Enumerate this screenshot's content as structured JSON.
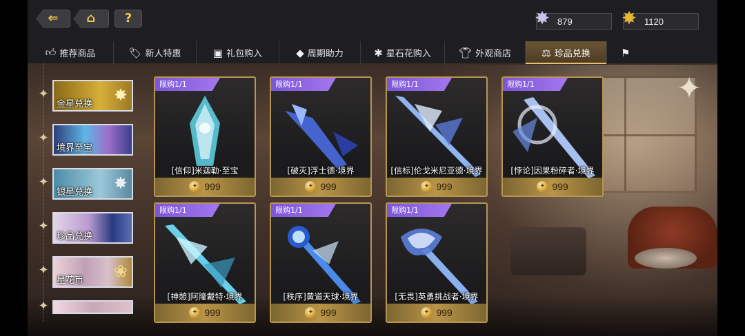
{
  "header": {
    "back_icon": "back-arrow-icon",
    "home_icon": "home-icon",
    "help_label": "?"
  },
  "currencies": [
    {
      "icon": "silver-star-icon",
      "value": "879"
    },
    {
      "icon": "gold-star-icon",
      "value": "1120"
    }
  ],
  "tabs": [
    {
      "label": "推荐商品",
      "icon": "thumbs-up-icon"
    },
    {
      "label": "新人特惠",
      "icon": "gift-tag-icon"
    },
    {
      "label": "礼包购入",
      "icon": "gift-box-icon"
    },
    {
      "label": "周期助力",
      "icon": "diamond-tag-icon"
    },
    {
      "label": "星石花购入",
      "icon": "star-flower-icon"
    },
    {
      "label": "外观商店",
      "icon": "shirt-icon"
    },
    {
      "label": "珍品兑换",
      "icon": "scales-icon",
      "active": true
    },
    {
      "label": "",
      "icon": "more-icon"
    }
  ],
  "sidenav": [
    {
      "label": "金星兑换",
      "active": true
    },
    {
      "label": "境界至宝"
    },
    {
      "label": "银星兑换"
    },
    {
      "label": "珍品兑换"
    },
    {
      "label": "星花币"
    },
    {
      "label": ""
    }
  ],
  "cards": [
    {
      "limit": "限购1/1",
      "name": "[信仰]米迦勒·至宝",
      "price": "999",
      "art": "#5fd6e8"
    },
    {
      "limit": "限购1/1",
      "name": "[破灭]浮士德·境界",
      "price": "999",
      "art": "#4a6be0"
    },
    {
      "limit": "限购1/1",
      "name": "[信标]伦戈米尼亚德·境界",
      "price": "999",
      "art": "#8fb4f0"
    },
    {
      "limit": "限购1/1",
      "name": "[悖论]因果粉碎者·境界",
      "price": "999",
      "art": "#a8c0f0"
    },
    {
      "limit": "限购1/1",
      "name": "[神憩]阿隆戴特·境界",
      "price": "999",
      "art": "#6ad0e8"
    },
    {
      "limit": "限购1/1",
      "name": "[秩序]黄道天球·境界",
      "price": "999",
      "art": "#4a8ae8"
    },
    {
      "limit": "限购1/1",
      "name": "[无畏]英勇挑战者·境界",
      "price": "999",
      "art": "#8ab0ee"
    }
  ],
  "colors": {
    "accent_gold": "#e8c070",
    "tag_purple": "#8d63e6",
    "card_border": "#b89552"
  }
}
